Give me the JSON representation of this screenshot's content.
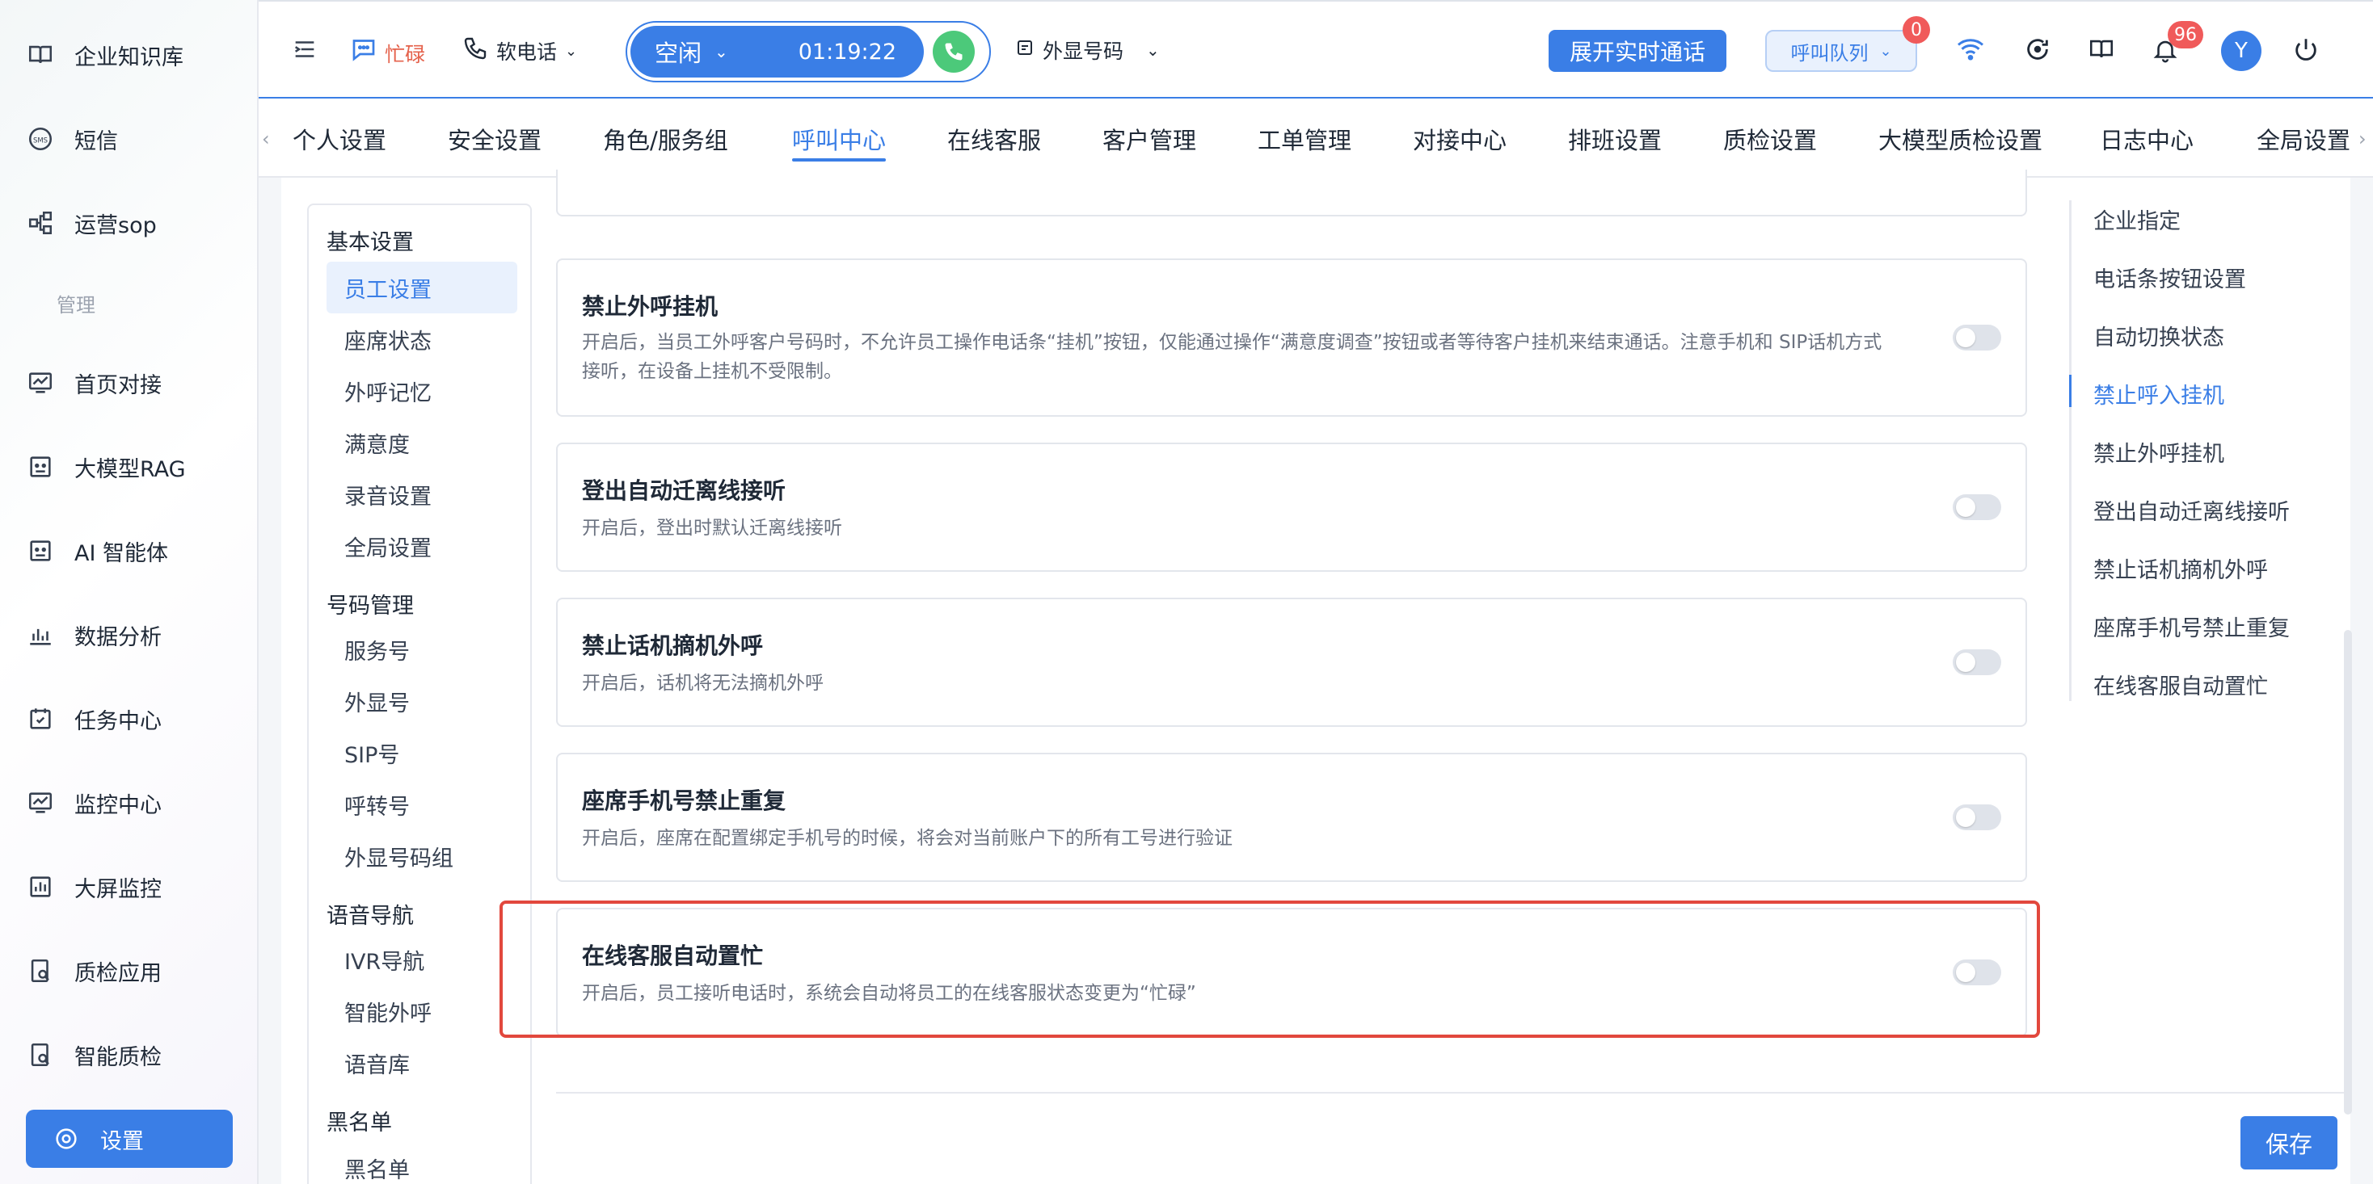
{
  "sidebar": {
    "items": [
      {
        "label": "企业知识库",
        "icon": "book-icon"
      },
      {
        "label": "短信",
        "icon": "sms-icon"
      },
      {
        "label": "运营sop",
        "icon": "flow-icon"
      }
    ],
    "section_label": "管理",
    "manage_items": [
      {
        "label": "首页对接",
        "icon": "dashboard-icon"
      },
      {
        "label": "大模型RAG",
        "icon": "robot-icon"
      },
      {
        "label": "AI 智能体",
        "icon": "agent-icon"
      },
      {
        "label": "数据分析",
        "icon": "bar-chart-icon"
      },
      {
        "label": "任务中心",
        "icon": "calendar-check-icon"
      },
      {
        "label": "监控中心",
        "icon": "monitor-icon"
      },
      {
        "label": "大屏监控",
        "icon": "big-screen-icon"
      },
      {
        "label": "质检应用",
        "icon": "inspect-icon"
      },
      {
        "label": "智能质检",
        "icon": "smart-inspect-icon"
      }
    ],
    "settings_label": "设置"
  },
  "topbar": {
    "busy_label": "忙碌",
    "softphone_label": "软电话",
    "status_label": "空闲",
    "timer": "01:19:22",
    "outbound_number_label": "外显号码",
    "realtime_button": "展开实时通话",
    "queue_button": "呼叫队列",
    "queue_badge": "0",
    "notification_badge": "96",
    "avatar_initial": "Y"
  },
  "tabs": [
    {
      "label": "个人设置"
    },
    {
      "label": "安全设置"
    },
    {
      "label": "角色/服务组"
    },
    {
      "label": "呼叫中心",
      "active": true
    },
    {
      "label": "在线客服"
    },
    {
      "label": "客户管理"
    },
    {
      "label": "工单管理"
    },
    {
      "label": "对接中心"
    },
    {
      "label": "排班设置"
    },
    {
      "label": "质检设置"
    },
    {
      "label": "大模型质检设置"
    },
    {
      "label": "日志中心"
    },
    {
      "label": "全局设置"
    }
  ],
  "subnav": {
    "groups": [
      {
        "title": "基本设置",
        "items": [
          "员工设置",
          "座席状态",
          "外呼记忆",
          "满意度",
          "录音设置",
          "全局设置"
        ]
      },
      {
        "title": "号码管理",
        "items": [
          "服务号",
          "外显号",
          "SIP号",
          "呼转号",
          "外显号码组"
        ]
      },
      {
        "title": "语音导航",
        "items": [
          "IVR导航",
          "智能外呼",
          "语音库"
        ]
      },
      {
        "title": "黑名单",
        "items": [
          "黑名单"
        ]
      }
    ]
  },
  "settings": [
    {
      "title": "禁止外呼挂机",
      "desc": "开启后，当员工外呼客户号码时，不允许员工操作电话条“挂机”按钮，仅能通过操作“满意度调查”按钮或者等待客户挂机来结束通话。注意手机和 SIP话机方式接听，在设备上挂机不受限制。",
      "enabled": false
    },
    {
      "title": "登出自动迁离线接听",
      "desc": "开启后，登出时默认迁离线接听",
      "enabled": false
    },
    {
      "title": "禁止话机摘机外呼",
      "desc": "开启后，话机将无法摘机外呼",
      "enabled": false
    },
    {
      "title": "座席手机号禁止重复",
      "desc": "开启后，座席在配置绑定手机号的时候，将会对当前账户下的所有工号进行验证",
      "enabled": false
    },
    {
      "title": "在线客服自动置忙",
      "desc": "开启后，员工接听电话时，系统会自动将员工的在线客服状态变更为“忙碌”",
      "enabled": false
    }
  ],
  "anchors": [
    {
      "label": "企业指定"
    },
    {
      "label": "电话条按钮设置"
    },
    {
      "label": "自动切换状态"
    },
    {
      "label": "禁止呼入挂机",
      "active": true
    },
    {
      "label": "禁止外呼挂机"
    },
    {
      "label": "登出自动迁离线接听"
    },
    {
      "label": "禁止话机摘机外呼"
    },
    {
      "label": "座席手机号禁止重复"
    },
    {
      "label": "在线客服自动置忙"
    }
  ],
  "save_button": "保存",
  "colors": {
    "accent": "#3a7ee6",
    "highlight": "#e2483d",
    "busy": "#e5624c",
    "call_green": "#4cc97a"
  }
}
